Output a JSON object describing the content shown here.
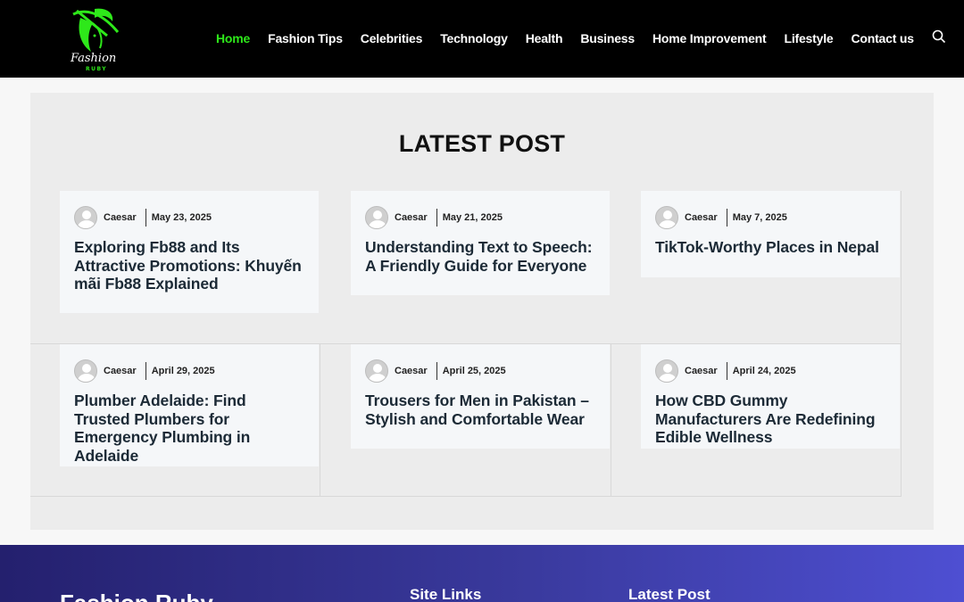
{
  "header": {
    "logo_alt": "Fashion Ruby",
    "nav": [
      {
        "label": "Home",
        "active": true
      },
      {
        "label": "Fashion Tips",
        "active": false
      },
      {
        "label": "Celebrities",
        "active": false
      },
      {
        "label": "Technology",
        "active": false
      },
      {
        "label": "Health",
        "active": false
      },
      {
        "label": "Business",
        "active": false
      },
      {
        "label": "Home Improvement",
        "active": false
      },
      {
        "label": "Lifestyle",
        "active": false
      },
      {
        "label": "Contact us",
        "active": false
      }
    ],
    "search_icon": "search-icon",
    "accent_color": "#2ee81a"
  },
  "latest": {
    "title": "LATEST POST",
    "posts": [
      {
        "author": "Caesar",
        "date": "May 23, 2025",
        "title": "Exploring Fb88 and Its Attractive Promotions: Khuyến mãi Fb88 Explained"
      },
      {
        "author": "Caesar",
        "date": "May 21, 2025",
        "title": "Understanding Text to Speech: A Friendly Guide for Everyone"
      },
      {
        "author": "Caesar",
        "date": "May 7, 2025",
        "title": "TikTok-Worthy Places in Nepal"
      },
      {
        "author": "Caesar",
        "date": "April 29, 2025",
        "title": "Plumber Adelaide: Find Trusted Plumbers for Emergency Plumbing in Adelaide"
      },
      {
        "author": "Caesar",
        "date": "April 25, 2025",
        "title": "Trousers for Men in Pakistan – Stylish and Comfortable Wear"
      },
      {
        "author": "Caesar",
        "date": "April 24, 2025",
        "title": "How CBD Gummy Manufacturers Are Redefining Edible Wellness"
      }
    ]
  },
  "footer": {
    "brand": "Fashion Ruby",
    "site_links": "Site Links",
    "latest_post": "Latest Post"
  }
}
